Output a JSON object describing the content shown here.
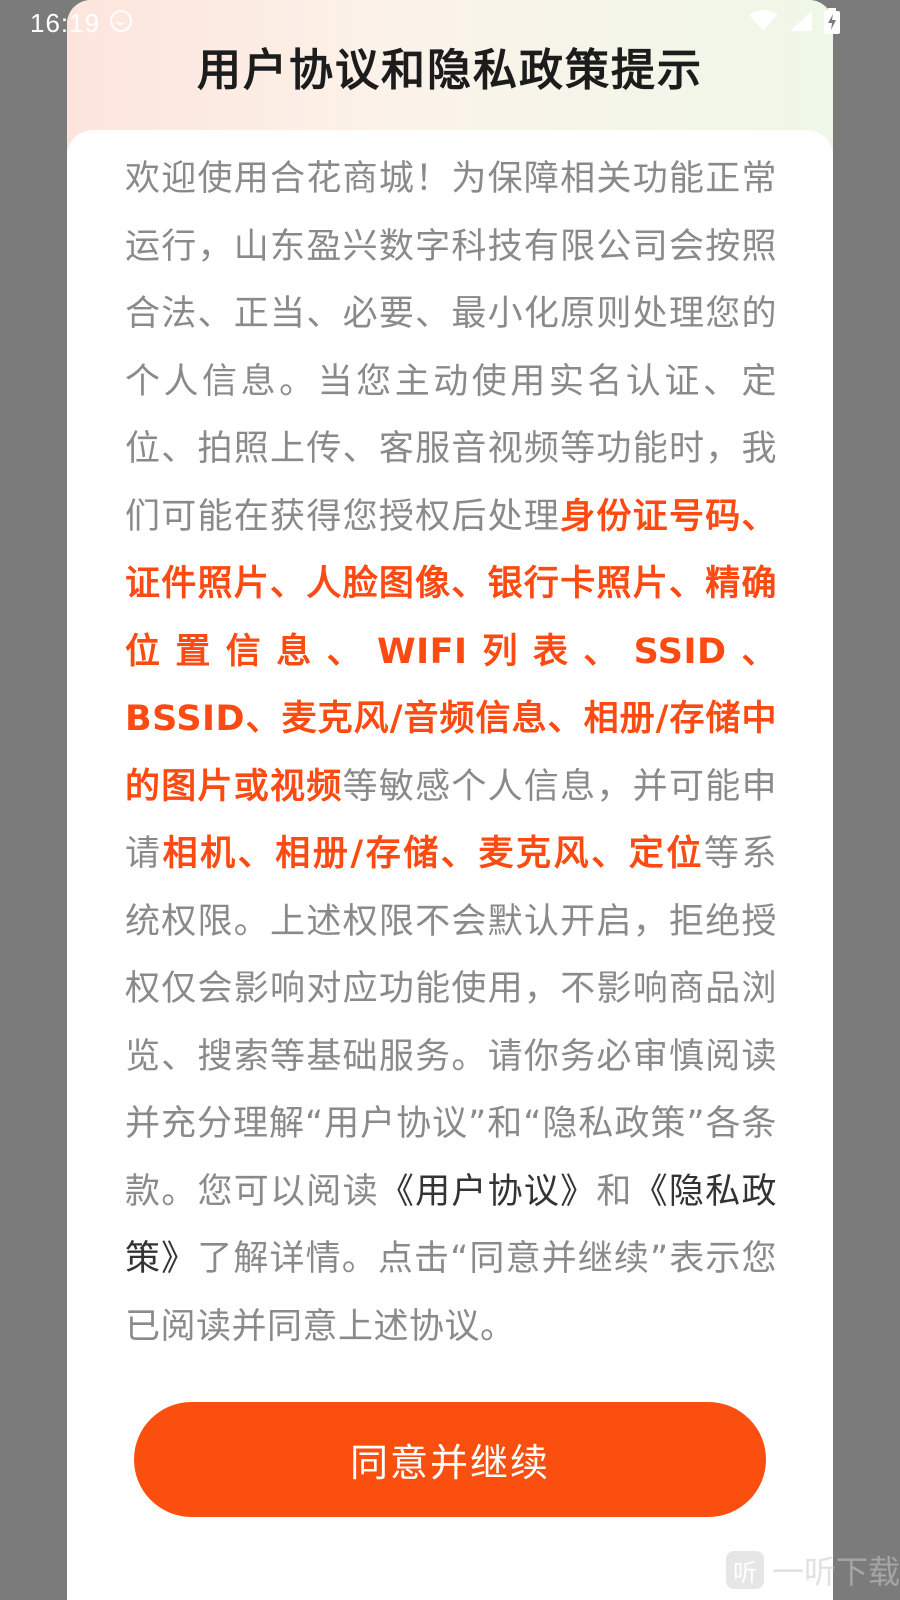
{
  "status_bar": {
    "time": "16:19",
    "icons": [
      "app-notification-icon",
      "wifi-icon",
      "signal-icon",
      "battery-charging-icon"
    ]
  },
  "dialog": {
    "title": "用户协议和隐私政策提示",
    "segments": [
      {
        "text": "欢迎使用合花商城！为保障相关功能正常运行，山东盈兴数字科技有限公司会按照合法、正当、必要、最小化原则处理您的个人信息。当您主动使用实名认证、定位、拍照上传、客服音视频等功能时，我们可能在获得您授权后处理",
        "style": "normal"
      },
      {
        "text": "身份证号码、证件照片、人脸图像、银行卡照片、精确位置信息、WIFI列表、SSID、BSSID、麦克风/音频信息、相册/存储中的图片或视频",
        "style": "highlight"
      },
      {
        "text": "等敏感个人信息，并可能申请",
        "style": "normal"
      },
      {
        "text": "相机、相册/存储、麦克风、定位",
        "style": "highlight"
      },
      {
        "text": "等系统权限。上述权限不会默认开启，拒绝授权仅会影响对应功能使用，不影响商品浏览、搜索等基础服务。请你务必审慎阅读并充分理解“用户协议”和“隐私政策”各条款。您可以阅读",
        "style": "normal"
      },
      {
        "text": "《用户协议》",
        "style": "link"
      },
      {
        "text": "和",
        "style": "normal"
      },
      {
        "text": "《隐私政策》",
        "style": "link"
      },
      {
        "text": "了解详情。点击“同意并继续”表示您已阅读并同意上述协议。",
        "style": "normal"
      }
    ],
    "agree_button": "同意并继续"
  },
  "watermark": {
    "icon_char": "听",
    "text": "一听下载"
  },
  "colors": {
    "highlight": "#fb4b12",
    "button": "#fb4f0f",
    "body_text": "#8a8a8a",
    "link_text": "#333333",
    "overlay": "#7b7b7b"
  }
}
